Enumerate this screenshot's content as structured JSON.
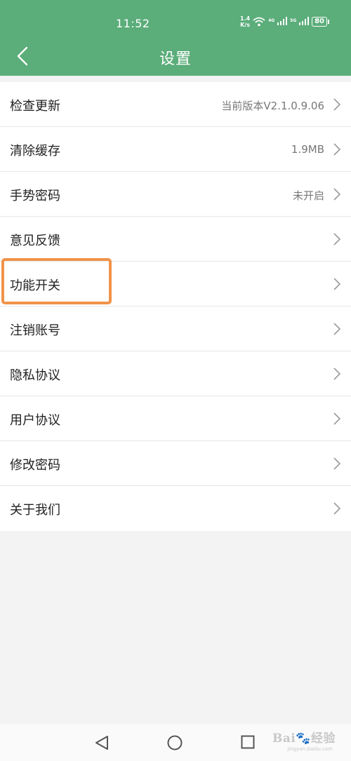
{
  "status_bar": {
    "time": "11:52",
    "net_speed_value": "1.4",
    "net_speed_unit": "K/s",
    "sig1": "4G",
    "sig2": "5G",
    "battery": "80"
  },
  "header": {
    "title": "设置",
    "accent_color": "#5bad7a"
  },
  "settings": [
    {
      "label": "检查更新",
      "value": "当前版本V2.1.0.9.06"
    },
    {
      "label": "清除缓存",
      "value": "1.9MB"
    },
    {
      "label": "手势密码",
      "value": "未开启"
    },
    {
      "label": "意见反馈",
      "value": ""
    },
    {
      "label": "功能开关",
      "value": ""
    },
    {
      "label": "注销账号",
      "value": ""
    },
    {
      "label": "隐私协议",
      "value": ""
    },
    {
      "label": "用户协议",
      "value": ""
    },
    {
      "label": "修改密码",
      "value": ""
    },
    {
      "label": "关于我们",
      "value": ""
    }
  ],
  "highlight_color": "#f0934a",
  "watermark": {
    "brand": "Bai",
    "brand2": "经验",
    "sub": "jingyan.baidu.com"
  }
}
